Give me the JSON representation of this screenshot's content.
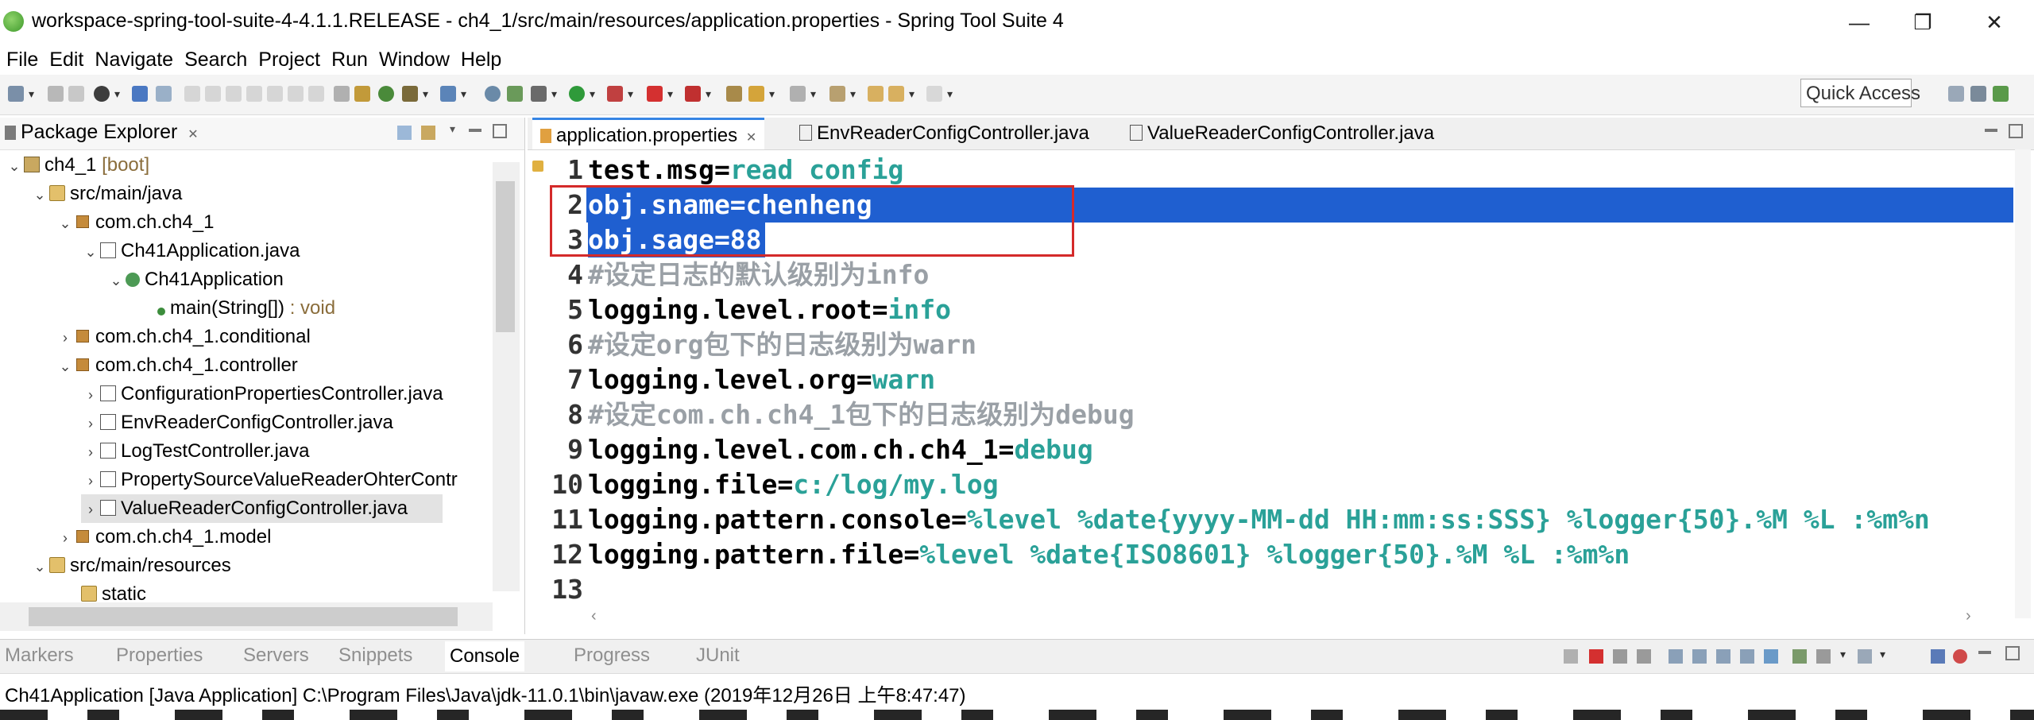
{
  "window": {
    "title": "workspace-spring-tool-suite-4-4.1.1.RELEASE - ch4_1/src/main/resources/application.properties - Spring Tool Suite 4",
    "minimize": "—",
    "restore": "❐",
    "close": "✕"
  },
  "menu": [
    "File",
    "Edit",
    "Navigate",
    "Search",
    "Project",
    "Run",
    "Window",
    "Help"
  ],
  "toolbar": {
    "quick_access": "Quick Access",
    "dropdown_glyph": "▾"
  },
  "package_explorer": {
    "title": "Package Explorer",
    "tab_close": "✕",
    "tree": [
      {
        "label": "ch4_1",
        "suffix": "[boot]",
        "icon": "project-icon"
      },
      {
        "label": "src/main/java",
        "icon": "source-folder-icon"
      },
      {
        "label": "com.ch.ch4_1",
        "icon": "package-icon"
      },
      {
        "label": "Ch41Application.java",
        "icon": "java-file-icon"
      },
      {
        "label": "Ch41Application",
        "icon": "class-icon"
      },
      {
        "label": "main(String[])",
        "suffix": ": void",
        "icon": "method-icon"
      },
      {
        "label": "com.ch.ch4_1.conditional",
        "icon": "package-icon"
      },
      {
        "label": "com.ch.ch4_1.controller",
        "icon": "package-icon"
      },
      {
        "label": "ConfigurationPropertiesController.java",
        "icon": "java-file-icon"
      },
      {
        "label": "EnvReaderConfigController.java",
        "icon": "java-file-icon"
      },
      {
        "label": "LogTestController.java",
        "icon": "java-file-icon"
      },
      {
        "label": "PropertySourceValueReaderOhterContr",
        "icon": "java-file-icon"
      },
      {
        "label": "ValueReaderConfigController.java",
        "icon": "java-file-icon"
      },
      {
        "label": "com.ch.ch4_1.model",
        "icon": "package-icon"
      },
      {
        "label": "src/main/resources",
        "icon": "source-folder-icon"
      },
      {
        "label": "static",
        "icon": "folder-icon"
      }
    ]
  },
  "editor": {
    "tabs": [
      {
        "label": "application.properties",
        "close": "✕",
        "active": true
      },
      {
        "label": "EnvReaderConfigController.java",
        "active": false
      },
      {
        "label": "ValueReaderConfigController.java",
        "active": false
      }
    ],
    "lines": [
      {
        "n": "1",
        "key": "test.msg=",
        "value": "read config"
      },
      {
        "n": "2",
        "key": "obj.sname=chenheng",
        "value": ""
      },
      {
        "n": "3",
        "key": "obj.sage=88",
        "value": ""
      },
      {
        "n": "4",
        "comment": "#设定日志的默认级别为info"
      },
      {
        "n": "5",
        "key": "logging.level.root=",
        "value": "info"
      },
      {
        "n": "6",
        "comment": "#设定org包下的日志级别为warn"
      },
      {
        "n": "7",
        "key": "logging.level.org=",
        "value": "warn"
      },
      {
        "n": "8",
        "comment": "#设定com.ch.ch4_1包下的日志级别为debug"
      },
      {
        "n": "9",
        "key": "logging.level.com.ch.ch4_1=",
        "value": "debug"
      },
      {
        "n": "10",
        "key": "logging.file=",
        "value": "c:/log/my.log"
      },
      {
        "n": "11",
        "key": "logging.pattern.console=",
        "value": "%level %date{yyyy-MM-dd HH:mm:ss:SSS} %logger{50}.%M %L :%m%n"
      },
      {
        "n": "12",
        "key": "logging.pattern.file=",
        "value": "%level %date{ISO8601} %logger{50}.%M %L :%m%n"
      },
      {
        "n": "13",
        "key": "",
        "value": ""
      }
    ]
  },
  "bottom_panel": {
    "tabs": [
      "Markers",
      "Properties",
      "Servers",
      "Snippets",
      "Console",
      "Progress",
      "JUnit"
    ],
    "active_tab": "Console",
    "console_description": "Ch41Application [Java Application] C:\\Program Files\\Java\\jdk-11.0.1\\bin\\javaw.exe (2019年12月26日 上午8:47:47)"
  },
  "colors": {
    "selection": "#2f65c4",
    "value_teal": "#2aa198",
    "comment_gray": "#9aa0a6",
    "annotation_red": "#d42a2a"
  }
}
